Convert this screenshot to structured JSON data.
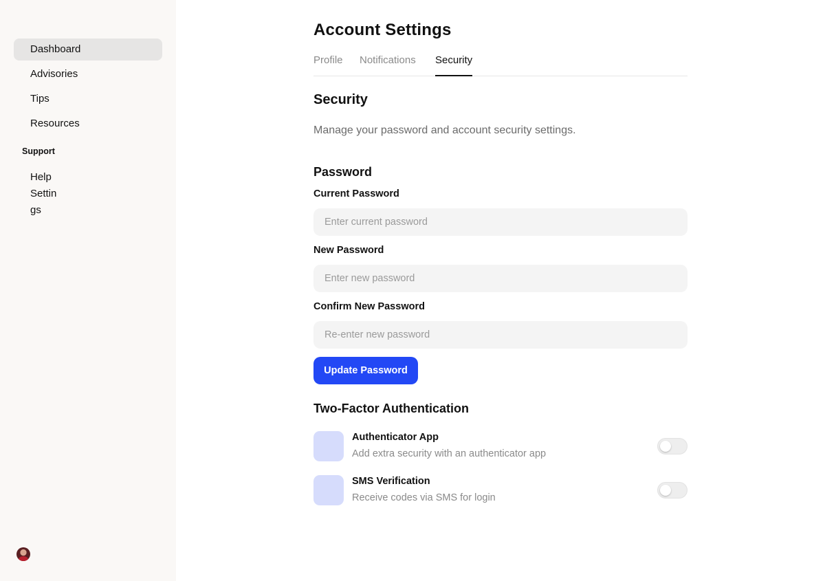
{
  "sidebar": {
    "nav": [
      {
        "label": "Dashboard"
      },
      {
        "label": "Advisories"
      },
      {
        "label": "Tips"
      },
      {
        "label": "Resources"
      }
    ],
    "support_label": "Support",
    "support_items": [
      {
        "label": "Help"
      },
      {
        "label": "Settings"
      }
    ]
  },
  "page": {
    "title": "Account Settings",
    "tabs": [
      {
        "label": "Profile"
      },
      {
        "label": "Notifications"
      },
      {
        "label": "Security"
      }
    ],
    "active_tab": "Security"
  },
  "security": {
    "title": "Security",
    "description": "Manage your password and account security settings.",
    "password": {
      "title": "Password",
      "current_label": "Current Password",
      "current_placeholder": "Enter current password",
      "new_label": "New Password",
      "new_placeholder": "Enter new password",
      "confirm_label": "Confirm New Password",
      "confirm_placeholder": "Re-enter new password",
      "button": "Update Password"
    },
    "two_factor": {
      "title": "Two-Factor Authentication",
      "options": [
        {
          "name": "Authenticator App",
          "description": "Add extra security with an authenticator app",
          "enabled": false
        },
        {
          "name": "SMS Verification",
          "description": "Receive codes via SMS for login",
          "enabled": false
        }
      ]
    }
  },
  "colors": {
    "accent": "#2348f5",
    "sidebar_bg": "#faf8f6",
    "icon_bg": "#d6dcfc"
  }
}
